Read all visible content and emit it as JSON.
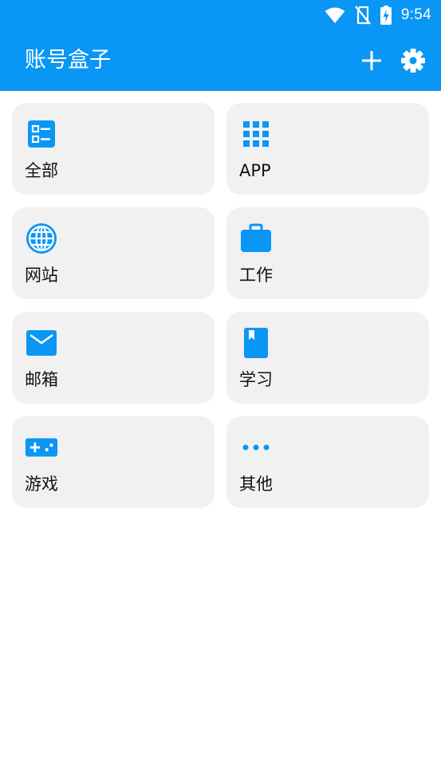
{
  "status_bar": {
    "time": "9:54"
  },
  "app_bar": {
    "title": "账号盒子"
  },
  "theme": {
    "primary": "#0a96f4",
    "tile_bg": "#f1f1f1",
    "icon_color": "#0a96f4"
  },
  "categories": [
    {
      "label": "全部",
      "icon": "list-icon"
    },
    {
      "label": "APP",
      "icon": "apps-grid-icon"
    },
    {
      "label": "网站",
      "icon": "globe-icon"
    },
    {
      "label": "工作",
      "icon": "briefcase-icon"
    },
    {
      "label": "邮箱",
      "icon": "mail-icon"
    },
    {
      "label": "学习",
      "icon": "book-icon"
    },
    {
      "label": "游戏",
      "icon": "gamepad-icon"
    },
    {
      "label": "其他",
      "icon": "more-dots-icon"
    }
  ]
}
